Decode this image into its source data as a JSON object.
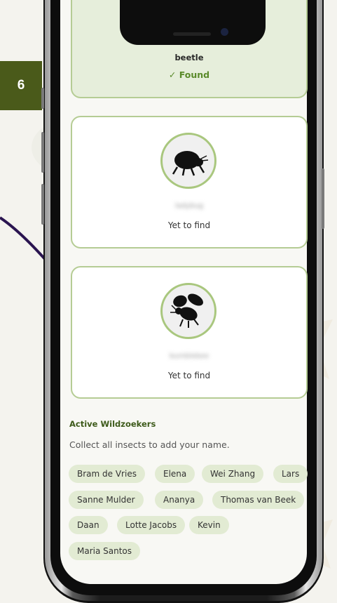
{
  "step_badge": "6",
  "cards": [
    {
      "name": "beetle",
      "status": "✓ Found",
      "icon": "beetle-icon"
    },
    {
      "name": "ladybug",
      "status": "Yet to find",
      "icon": "beetle-silhouette-icon"
    },
    {
      "name": "bumblebee",
      "status": "Yet to find",
      "icon": "bee-silhouette-icon"
    }
  ],
  "section": {
    "title": "Active Wildzoekers",
    "subtitle": "Collect all insects to add your name."
  },
  "names": [
    "Bram de Vries",
    "Elena",
    "Wei Zhang",
    "Lars",
    "Sanne Mulder",
    "Ananya",
    "Thomas van Beek",
    "Daan",
    "Lotte Jacobs",
    "Kevin",
    "Maria Santos"
  ],
  "colors": {
    "accent_green": "#5a8a2a",
    "card_border": "#b5cc94",
    "chip_bg": "#e2ebd3",
    "badge_bg": "#4a5a1a",
    "curve": "#2a1450"
  }
}
